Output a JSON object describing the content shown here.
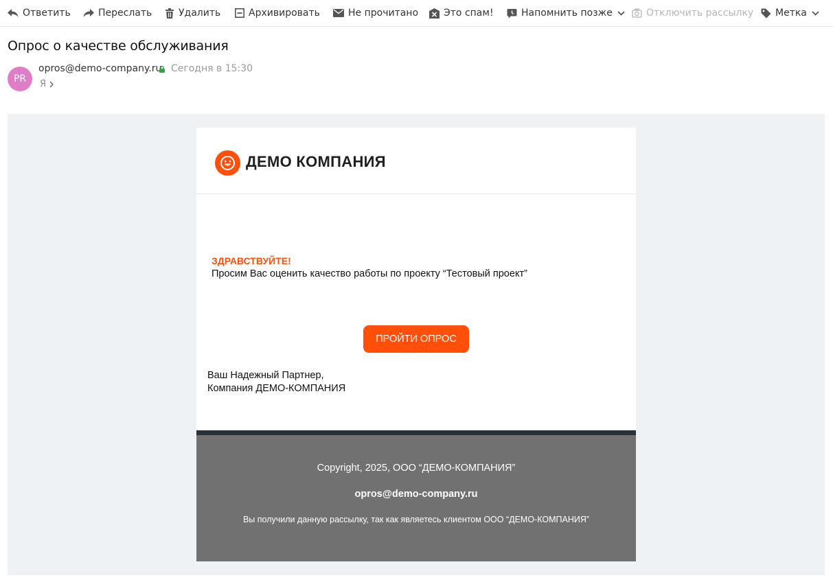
{
  "toolbar": {
    "reply": "Ответить",
    "forward": "Переслать",
    "delete": "Удалить",
    "archive": "Архивировать",
    "unread": "Не прочитано",
    "spam": "Это спам!",
    "remind": "Напомнить позже",
    "unsubscribe": "Отключить рассылку",
    "label": "Метка"
  },
  "message": {
    "subject": "Опрос о качестве обслуживания",
    "avatar_initials": "PR",
    "from": "opros@demo-company.ru",
    "date": "Сегодня в 15:30",
    "to": "Я"
  },
  "email": {
    "brand": "ДЕМО КОМПАНИЯ",
    "greeting": "ЗДРАВСТВУЙТЕ!",
    "request": "Просим Вас оценить качество работы по проекту “Тестовый проект”",
    "cta": "ПРОЙТИ ОПРОС",
    "sign_line1": "Ваш Надежный Партнер,",
    "sign_line2": "Компания ДЕМО-КОМПАНИЯ",
    "footer_copyright": "Copyright, 2025, ООО “ДЕМО-КОМПАНИЯ”",
    "footer_email": "opros@demo-company.ru",
    "footer_note": "Вы получили данную рассылку, так как являетесь клиентом ООО “ДЕМО-КОМПАНИЯ”"
  },
  "colors": {
    "accent": "#ff4f0a",
    "avatar": "#df7ec6",
    "footer": "#717171",
    "footer_bar": "#27313a",
    "canvas": "#eef2f5"
  },
  "icons": [
    "reply-icon",
    "forward-icon",
    "trash-icon",
    "archive-icon",
    "envelope-icon",
    "spam-icon",
    "reminder-icon",
    "chevron-down-icon",
    "unsubscribe-icon",
    "tag-icon",
    "lock-icon",
    "chevron-right-icon",
    "smile-logo-icon"
  ]
}
